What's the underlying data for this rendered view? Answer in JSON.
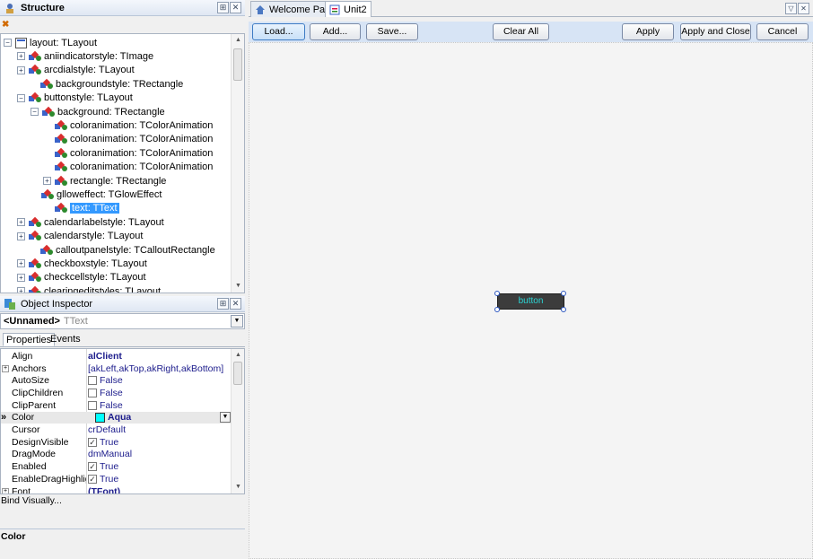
{
  "structure": {
    "title": "Structure",
    "tree": [
      {
        "label": "layout: TLayout",
        "exp": "-",
        "icon": "layout"
      },
      {
        "label": "aniindicatorstyle: TImage",
        "exp": "+"
      },
      {
        "label": "arcdialstyle: TLayout",
        "exp": "+"
      },
      {
        "label": "backgroundstyle: TRectangle",
        "exp": ""
      },
      {
        "label": "buttonstyle: TLayout",
        "exp": "-"
      },
      {
        "label": "background: TRectangle",
        "exp": "-"
      },
      {
        "label": "coloranimation: TColorAnimation",
        "exp": ""
      },
      {
        "label": "coloranimation: TColorAnimation",
        "exp": ""
      },
      {
        "label": "coloranimation: TColorAnimation",
        "exp": ""
      },
      {
        "label": "coloranimation: TColorAnimation",
        "exp": ""
      },
      {
        "label": "rectangle: TRectangle",
        "exp": "+"
      },
      {
        "label": "glloweffect: TGlowEffect",
        "exp": ""
      },
      {
        "label": "text: TText",
        "exp": "",
        "selected": true
      },
      {
        "label": "calendarlabelstyle: TLayout",
        "exp": "+"
      },
      {
        "label": "calendarstyle: TLayout",
        "exp": "+"
      },
      {
        "label": "calloutpanelstyle: TCalloutRectangle",
        "exp": ""
      },
      {
        "label": "checkboxstyle: TLayout",
        "exp": "+"
      },
      {
        "label": "checkcellstyle: TLayout",
        "exp": "+"
      },
      {
        "label": "clearingeditstyles: TLayout",
        "exp": "+"
      }
    ]
  },
  "inspector": {
    "title": "Object Inspector",
    "object_name": "<Unnamed>",
    "object_type": "TText",
    "tabs": [
      "Properties",
      "Events"
    ],
    "properties": [
      {
        "name": "Align",
        "value": "alClient",
        "bold": true
      },
      {
        "name": "Anchors",
        "value": "[akLeft,akTop,akRight,akBottom]",
        "expand": true
      },
      {
        "name": "AutoSize",
        "value": "False",
        "check": false
      },
      {
        "name": "ClipChildren",
        "value": "False",
        "check": false
      },
      {
        "name": "ClipParent",
        "value": "False",
        "check": false
      },
      {
        "name": "Color",
        "value": "Aqua",
        "bold": true,
        "color": "#00FFFF",
        "current": true
      },
      {
        "name": "Cursor",
        "value": "crDefault"
      },
      {
        "name": "DesignVisible",
        "value": "True",
        "check": true
      },
      {
        "name": "DragMode",
        "value": "dmManual"
      },
      {
        "name": "Enabled",
        "value": "True",
        "check": true
      },
      {
        "name": "EnableDragHighlight",
        "value": "True",
        "check": true
      },
      {
        "name": "Font",
        "value": "(TFont)",
        "bold": true,
        "expand": true
      }
    ],
    "bind_visually": "Bind Visually...",
    "description": "Color"
  },
  "tabs": [
    {
      "label": "Welcome Page",
      "active": false
    },
    {
      "label": "Unit2",
      "active": true
    }
  ],
  "toolbar": {
    "load": "Load...",
    "add": "Add...",
    "save": "Save...",
    "clear_all": "Clear All",
    "apply": "Apply",
    "apply_close": "Apply and Close",
    "cancel": "Cancel"
  },
  "canvas": {
    "button_text": "button"
  },
  "colors": {
    "selection": "#3399FF",
    "toolbar_bg": "#D7E4F5",
    "button_text": "#2BD6D6"
  }
}
